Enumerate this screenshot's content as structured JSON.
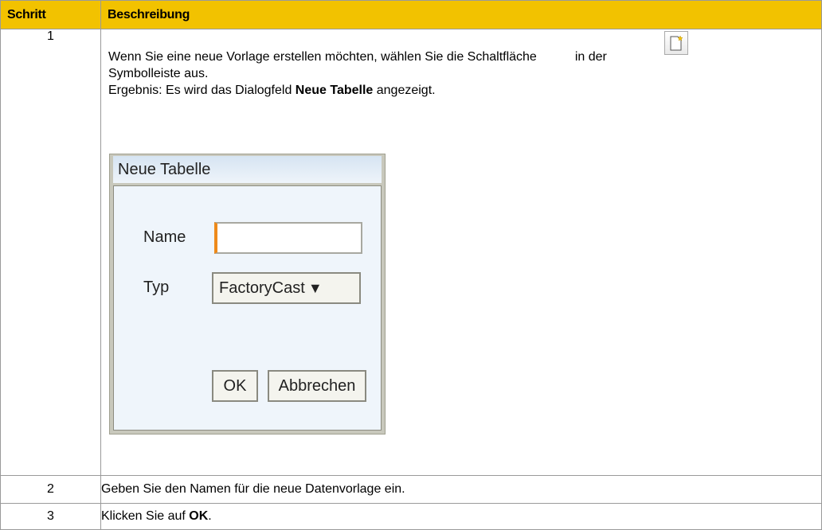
{
  "table": {
    "headers": {
      "step": "Schritt",
      "description": "Beschreibung"
    },
    "header_color": "#f2c200",
    "rows": [
      {
        "step": "1",
        "line1_before": "Wenn Sie eine neue Vorlage erstellen möchten, wählen Sie die Schaltfläche",
        "line1_after": "in der",
        "line2": "Symbolleiste aus.",
        "line3_before": "Ergebnis: Es wird das Dialogfeld ",
        "line3_bold": "Neue Tabelle",
        "line3_after": " angezeigt.",
        "toolbar_icon": "new-table-icon"
      },
      {
        "step": "2",
        "text": "Geben Sie den Namen für die neue Datenvorlage ein."
      },
      {
        "step": "3",
        "text_before": "Klicken Sie auf ",
        "text_bold": "OK",
        "text_after": "."
      }
    ]
  },
  "dialog": {
    "title": "Neue Tabelle",
    "name_label": "Name",
    "name_value": "",
    "type_label": "Typ",
    "type_value": "FactoryCast",
    "type_arrow": "▼",
    "ok_label": "OK",
    "cancel_label": "Abbrechen",
    "input_focus_color": "#ee8a1a"
  }
}
